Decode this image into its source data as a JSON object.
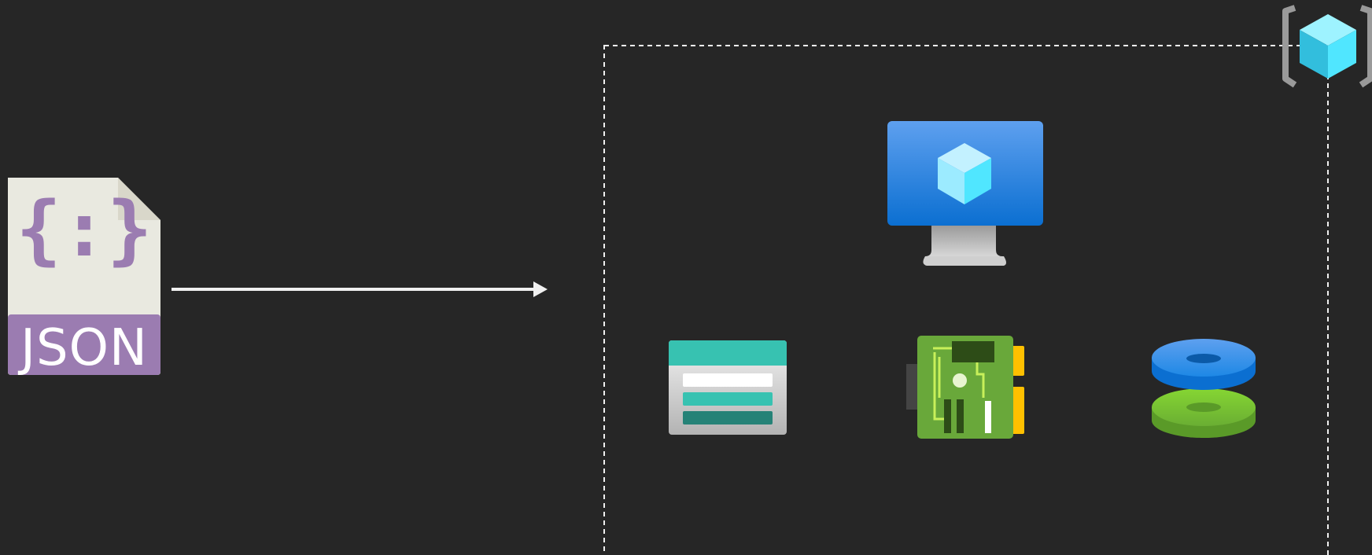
{
  "json_file": {
    "label": "JSON",
    "braces_glyph": "{:}",
    "icon": "json-file-icon"
  },
  "arrow": {
    "icon": "arrow-right-icon"
  },
  "resource_group": {
    "icon": "resource-group-icon",
    "children": [
      {
        "icon": "virtual-machine-icon"
      },
      {
        "icon": "storage-account-icon"
      },
      {
        "icon": "network-interface-icon"
      },
      {
        "icon": "managed-disks-icon"
      }
    ]
  },
  "colors": {
    "background": "#262626",
    "json_purple": "#9b7cb1",
    "json_paper": "#e9e9e0",
    "arrow": "#f0f0f0",
    "dashed_border": "#f0f0f0",
    "vm_blue_top": "#5ea0ef",
    "vm_blue_bottom": "#0b6fd1",
    "storage_teal": "#37c2b1",
    "nic_green": "#69a83a",
    "nic_yellow": "#ffc000",
    "disk_blue": "#1e88e5",
    "disk_green": "#6aae33",
    "cube_cyan": "#50e6ff"
  }
}
